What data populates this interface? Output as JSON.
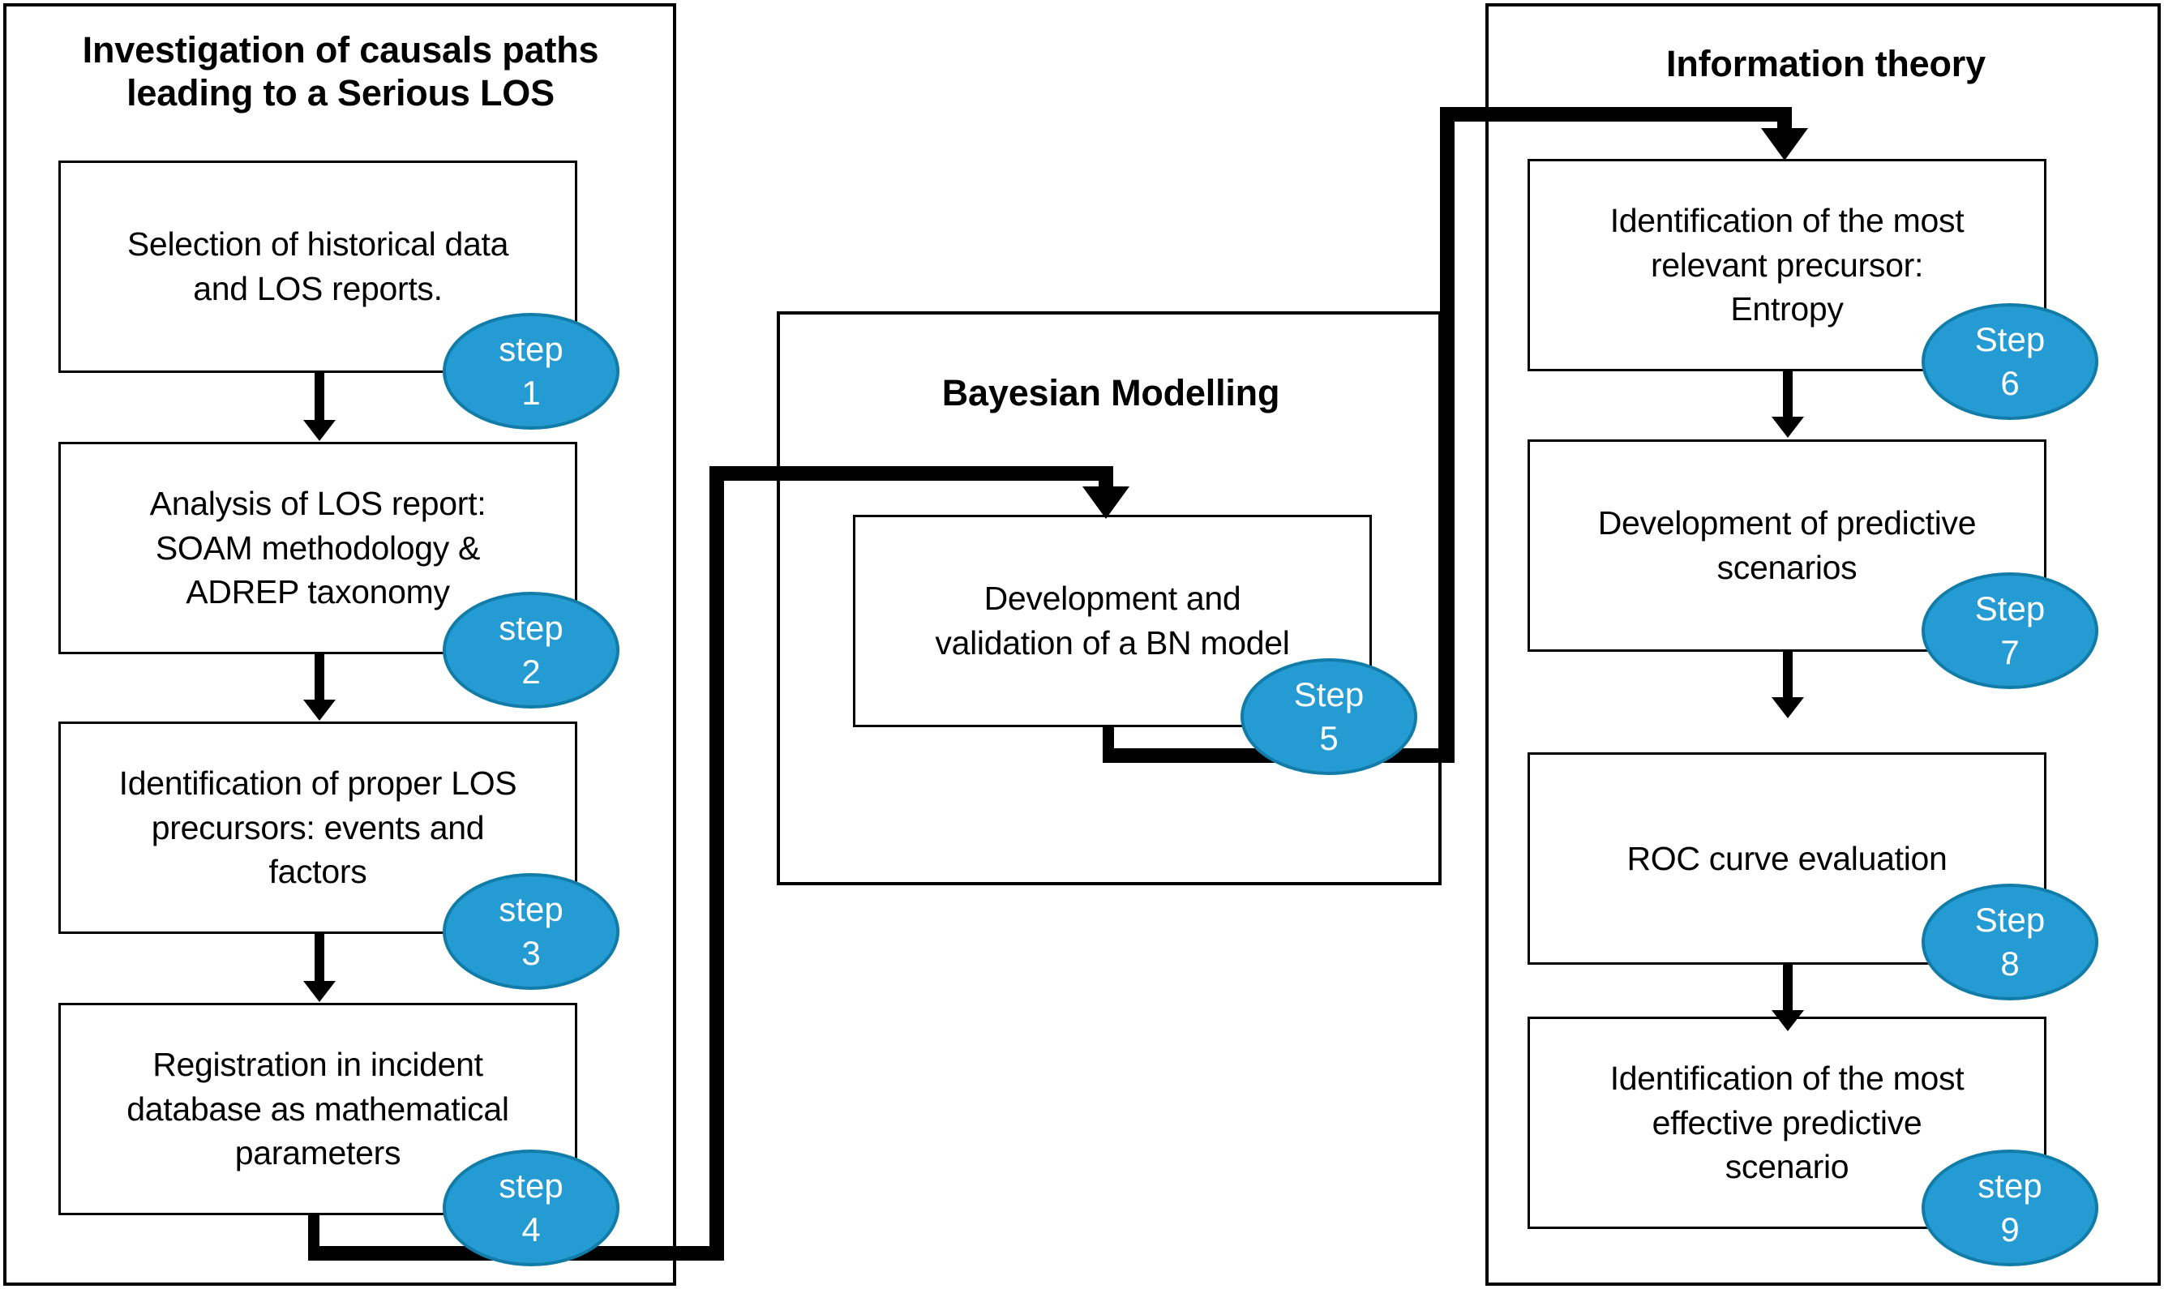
{
  "diagram": {
    "title": "Research methodology flowchart",
    "accent_color": "#249BD2",
    "accent_border_color": "#117CA8",
    "line_color": "#000000",
    "background_color": "#FFFFFF"
  },
  "panels": [
    {
      "id": "left",
      "title": "Investigation of causals paths\nleading to a Serious LOS"
    },
    {
      "id": "middle",
      "title": "Bayesian Modelling"
    },
    {
      "id": "right",
      "title": "Information theory"
    }
  ],
  "steps": [
    {
      "index": 1,
      "panel": "left",
      "text": "Selection of historical data\nand LOS reports.",
      "badge_word": "step",
      "badge_number": "1"
    },
    {
      "index": 2,
      "panel": "left",
      "text": "Analysis of LOS report:\nSOAM methodology &\nADREP taxonomy",
      "badge_word": "step",
      "badge_number": "2"
    },
    {
      "index": 3,
      "panel": "left",
      "text": "Identification of proper LOS\nprecursors: events and\nfactors",
      "badge_word": "step",
      "badge_number": "3"
    },
    {
      "index": 4,
      "panel": "left",
      "text": "Registration in incident\ndatabase as mathematical\nparameters",
      "badge_word": "step",
      "badge_number": "4"
    },
    {
      "index": 5,
      "panel": "middle",
      "text": "Development and\nvalidation of a BN model",
      "badge_word": "Step",
      "badge_number": "5"
    },
    {
      "index": 6,
      "panel": "right",
      "text": "Identification of the most\nrelevant precursor:\nEntropy",
      "badge_word": "Step",
      "badge_number": "6"
    },
    {
      "index": 7,
      "panel": "right",
      "text": "Development of predictive\nscenarios",
      "badge_word": "Step",
      "badge_number": "7"
    },
    {
      "index": 8,
      "panel": "right",
      "text": "ROC curve evaluation",
      "badge_word": "Step",
      "badge_number": "8"
    },
    {
      "index": 9,
      "panel": "right",
      "text": "Identification of the most\neffective predictive\nscenario",
      "badge_word": "step",
      "badge_number": "9"
    }
  ]
}
